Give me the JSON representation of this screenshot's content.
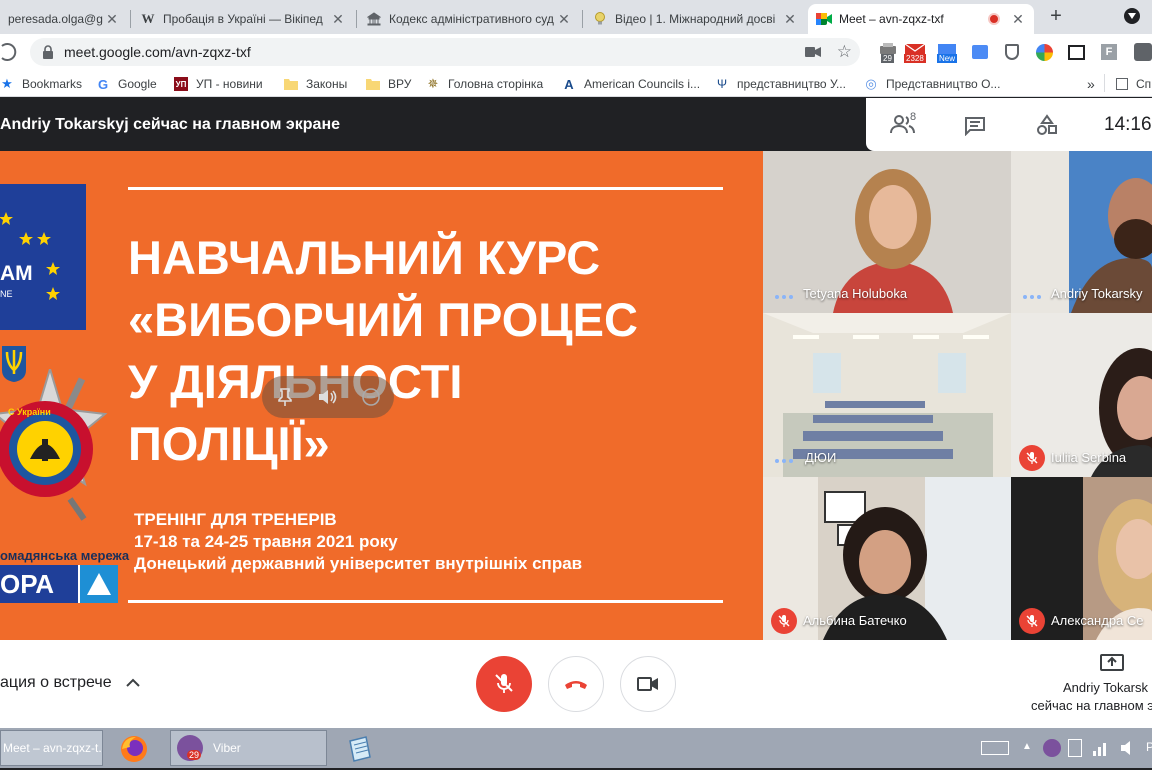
{
  "browser": {
    "tabs": [
      {
        "label": "peresada.olga@g",
        "icon": "mail-icon"
      },
      {
        "label": "Пробація в Україні — Вікіпед",
        "icon": "wikipedia-icon"
      },
      {
        "label": "Кодекс адміністративного суд",
        "icon": "government-building-icon"
      },
      {
        "label": "Відео | 1. Міжнародний досві",
        "icon": "bulb-icon"
      },
      {
        "label": "Meet – avn-zqxz-txf",
        "icon": "google-meet-icon",
        "active": true
      }
    ],
    "new_tab_label": "+",
    "address": "meet.google.com/avn-zqxz-txf",
    "extension_badges": {
      "badge1": "29",
      "badge2": "2328",
      "badge3": "New"
    },
    "bookmarks": [
      {
        "label": "Bookmarks",
        "icon": "star-icon"
      },
      {
        "label": "Google",
        "icon": "google-icon"
      },
      {
        "label": "УП - новини",
        "icon": "up-news-icon"
      },
      {
        "label": "Законы",
        "icon": "folder-icon"
      },
      {
        "label": "ВРУ",
        "icon": "folder-icon"
      },
      {
        "label": "Головна сторінка",
        "icon": "emblem-icon"
      },
      {
        "label": "American Councils i...",
        "icon": "ac-logo-icon"
      },
      {
        "label": "представництво У...",
        "icon": "trident-icon"
      },
      {
        "label": "Представництво О...",
        "icon": "un-icon"
      }
    ],
    "bookmarks_overflow": "»",
    "bookmarks_trailing": "Сп"
  },
  "meet": {
    "presenting_banner": "Andriy Tokarskyj сейчас на главном экране",
    "participant_count": "8",
    "clock": "14:16",
    "slide": {
      "heading_line1": "НАВЧАЛЬНИЙ КУРС",
      "heading_line2": "«ВИБОРЧИЙ ПРОЦЕС",
      "heading_line3": "У ДІЯЛЬНОСТІ",
      "heading_line4": "ПОЛІЦІЇ»",
      "sub_line1": "ТРЕНІНГ ДЛЯ ТРЕНЕРІВ",
      "sub_line2": "17-18 та 24-25 травня 2021 року",
      "sub_line3": "Донецький державний університет внутрішніх справ",
      "logo_eu_text": "AM",
      "logo_eu_text2": "NE",
      "logo_badge_text": "С України",
      "logo_network_text": "омадянська мережа",
      "logo_opora_text": "ОРА"
    },
    "participants": [
      {
        "name": "Tetyana Holuboka",
        "muted": false
      },
      {
        "name": "Andriy Tokarsky",
        "muted": false
      },
      {
        "name": "ДЮИ",
        "muted": false
      },
      {
        "name": "Iuliia Serbina",
        "muted": true
      },
      {
        "name": "Альбина Батечко",
        "muted": true
      },
      {
        "name": "Александра Се",
        "muted": true
      }
    ],
    "meeting_details_label": "ация о встрече",
    "presenter_line1": "Andriy Tokarsk",
    "presenter_line2": "сейчас на главном э"
  },
  "taskbar": {
    "items": [
      {
        "label": "Meet – avn-zqxz-t...",
        "icon": "chrome-icon"
      },
      {
        "label": "",
        "icon": "firefox-icon"
      },
      {
        "label": "Viber",
        "icon": "viber-icon",
        "badge": "29"
      },
      {
        "label": "",
        "icon": "notepad-icon"
      }
    ],
    "tray_lang": "Р"
  },
  "colors": {
    "slide_orange": "#f06b2a",
    "meet_red": "#ea4335",
    "eu_blue": "#1f3f99"
  }
}
